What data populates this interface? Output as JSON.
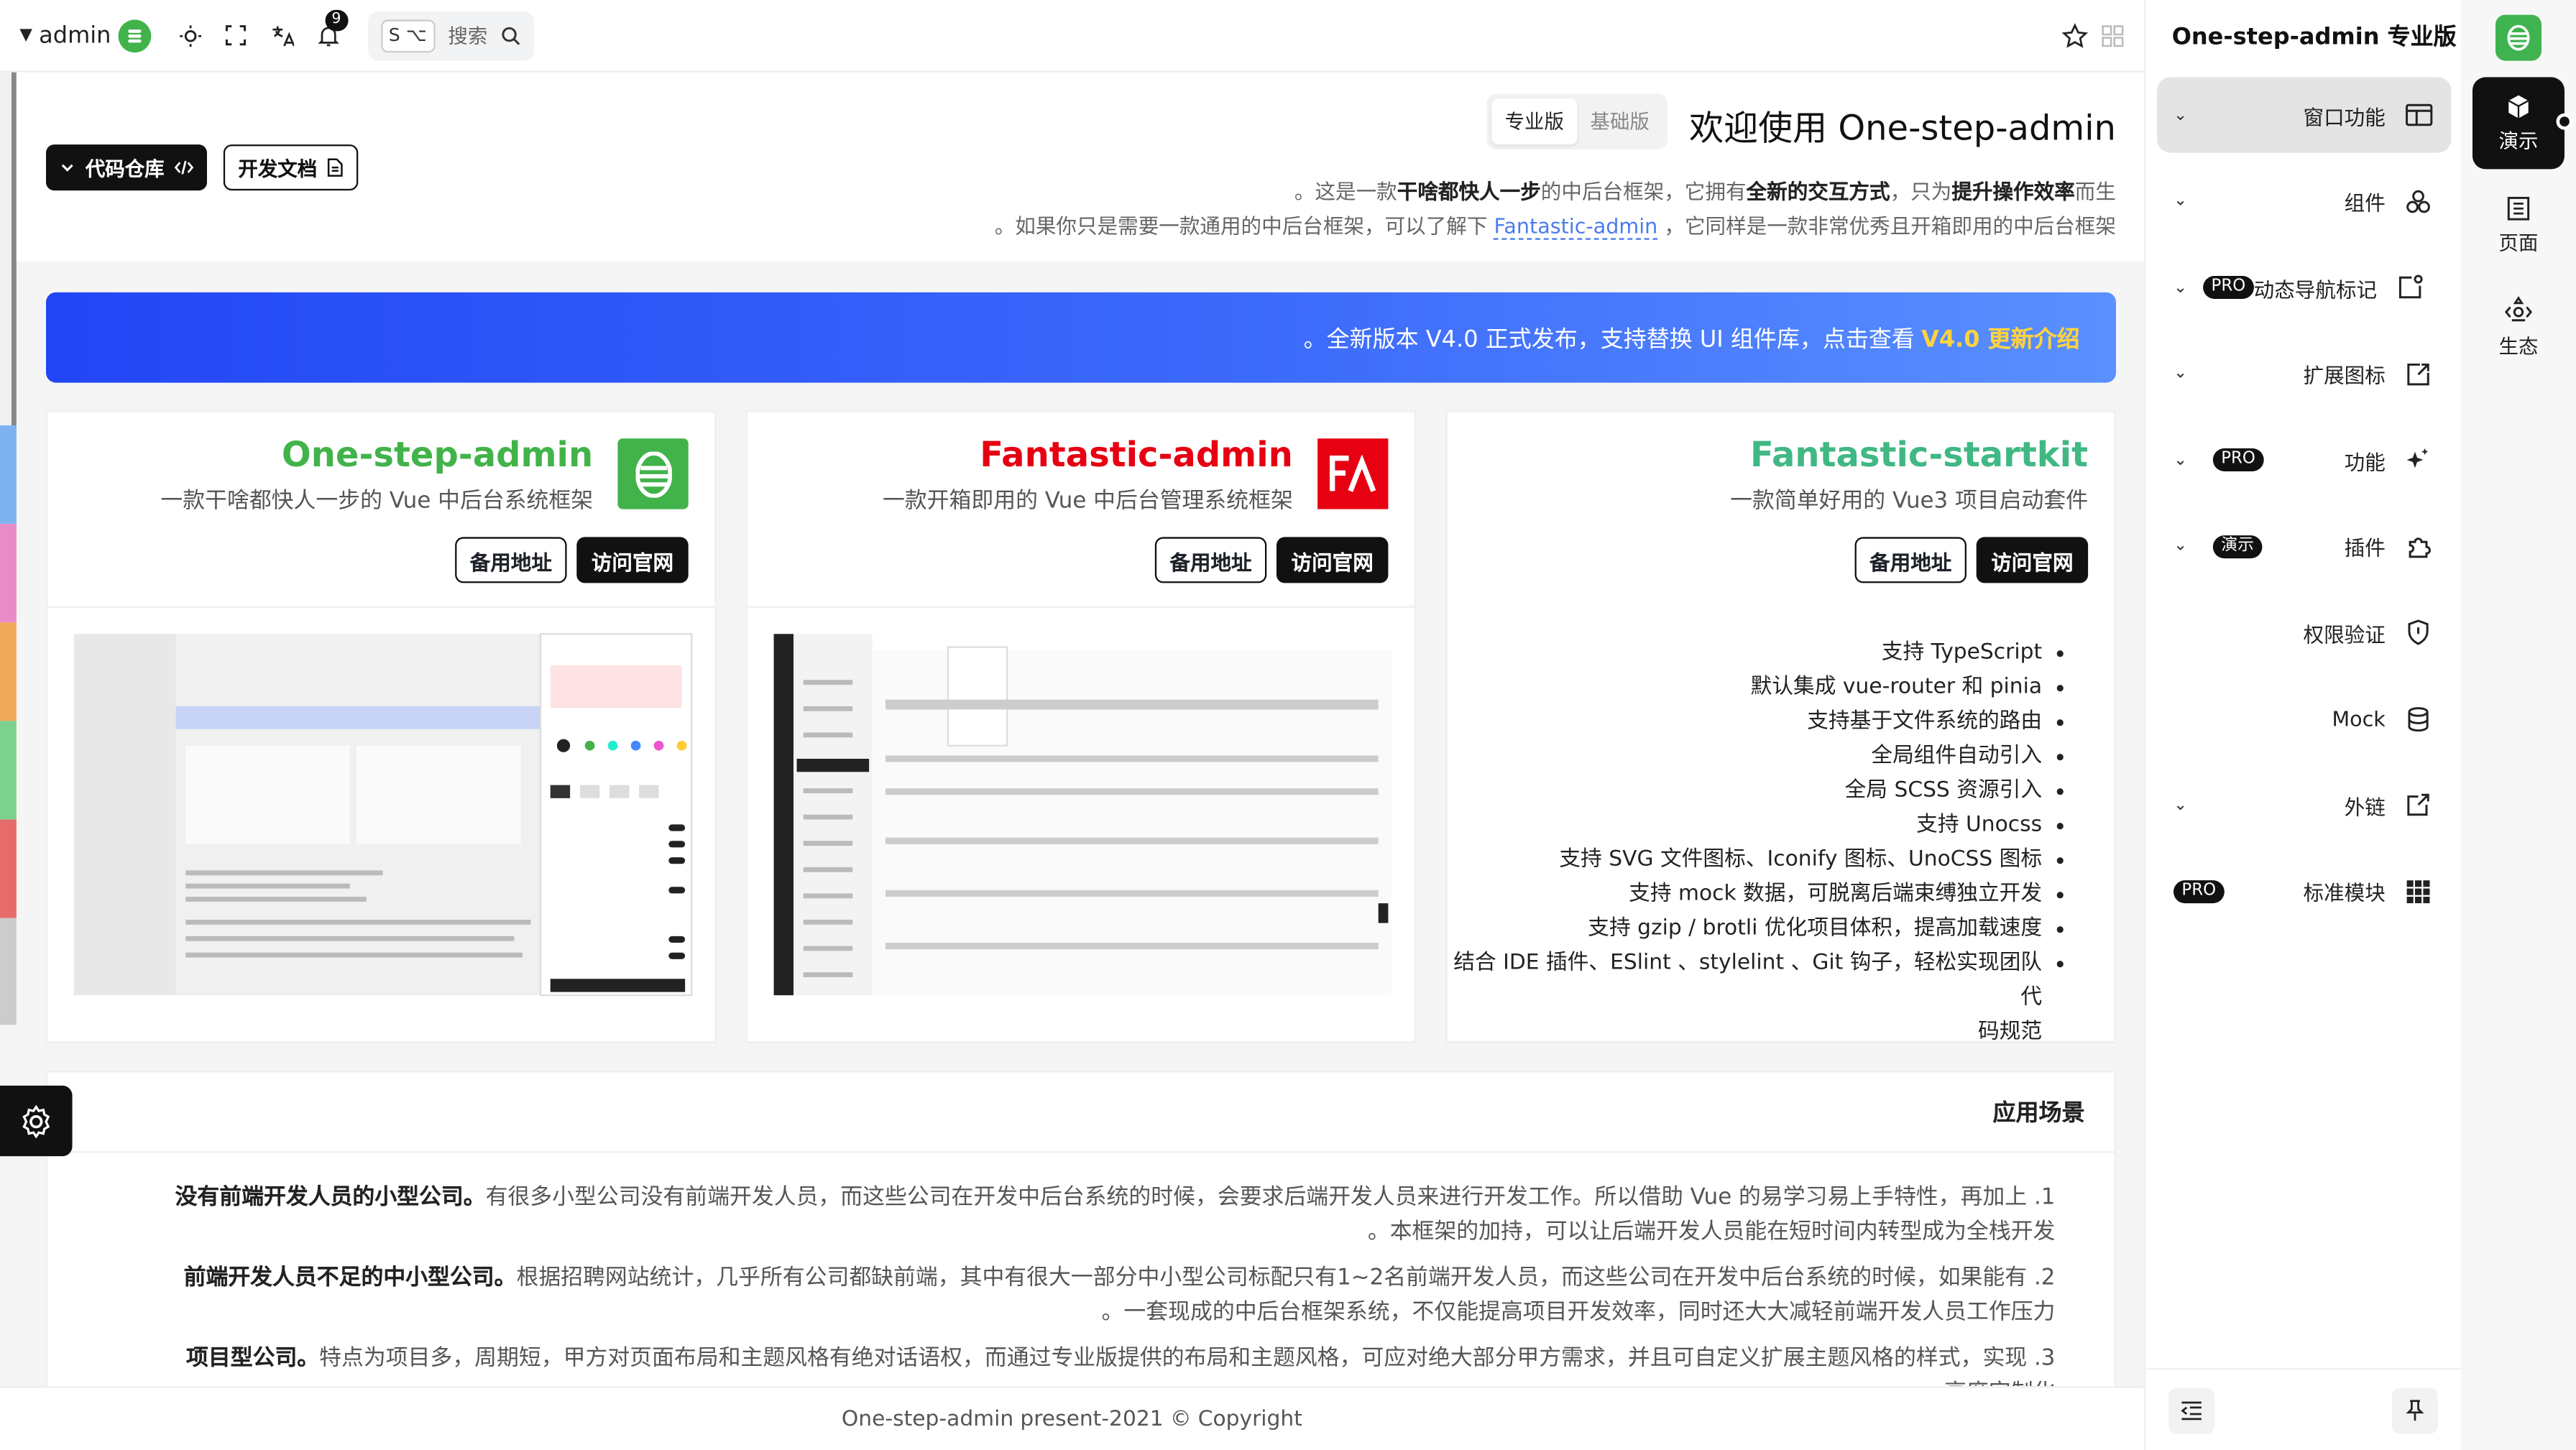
{
  "topbar": {
    "user": "admin",
    "notify_count": "9",
    "search_kbd": "S ⌥",
    "search_label": "搜索"
  },
  "hero": {
    "title": "欢迎使用 One-step-admin",
    "tab_pro": "专业版",
    "tab_basic": "基础版",
    "line1_pre": "。这是一款",
    "line1_b1": "干啥都快人一步",
    "line1_mid": "的中后台框架，它拥有",
    "line1_b2": "全新的交互方式",
    "line1_mid2": "，只为",
    "line1_b3": "提升操作效率",
    "line1_post": "而生",
    "line2_pre": "。如果你只是需要一款通用的中后台框架，可以了解下",
    "line2_link": "Fantastic-admin",
    "line2_post": "，它同样是一款非常优秀且开箱即用的中后台框架",
    "btn_repo": "代码仓库",
    "btn_docs": "开发文档"
  },
  "banner": {
    "text": "。全新版本 V4.0 正式发布，支持替换 UI 组件库，点击查看",
    "highlight": "V4.0 更新介绍"
  },
  "cards": [
    {
      "name": "One-step-admin",
      "desc": "一款干啥都快人一步的 Vue 中后台系统框架",
      "btn1": "备用地址",
      "btn2": "访问官网",
      "color": "#41b34a"
    },
    {
      "name": "Fantastic-admin",
      "desc": "一款开箱即用的 Vue 中后台管理系统框架",
      "btn1": "备用地址",
      "btn2": "访问官网",
      "color": "#e60012"
    },
    {
      "name": "Fantastic-startkit",
      "desc": "一款简单好用的 Vue3 项目启动套件",
      "btn1": "备用地址",
      "btn2": "访问官网",
      "color": "#41b883"
    }
  ],
  "features": [
    "支持 TypeScript",
    "默认集成 vue-router 和 pinia",
    "支持基于文件系统的路由",
    "全局组件自动引入",
    "全局 SCSS 资源引入",
    "支持 Unocss",
    "支持 SVG 文件图标、Iconify 图标、UnoCSS 图标",
    "支持 mock 数据，可脱离后端束缚独立开发",
    "支持 gzip / brotli 优化项目体积，提高加载速度",
    "结合 IDE 插件、ESlint 、stylelint 、Git 钩子，轻松实现团队代",
    "码规范"
  ],
  "scenarios": {
    "title": "应用场景",
    "items": [
      {
        "bold": "没有前端开发人员的小型公司。",
        "text": "有很多小型公司没有前端开发人员，而这些公司在开发中后台系统的时候，会要求后端开发人员来进行开发工作。所以借助 Vue 的易学习易上手特性，再加上 .1",
        "text2": "。本框架的加持，可以让后端开发人员能在短时间内转型成为全栈开发"
      },
      {
        "bold": "前端开发人员不足的中小型公司。",
        "text": "根据招聘网站统计，几乎所有公司都缺前端，其中有很大一部分中小型公司标配只有1~2名前端开发人员，而这些公司在开发中后台系统的时候，如果能有 .2",
        "text2": "。一套现成的中后台框架系统，不仅能提高项目开发效率，同时还大大减轻前端开发人员工作压力"
      },
      {
        "bold": "项目型公司。",
        "text": "特点为项目多，周期短，甲方对页面布局和主题风格有绝对话语权，而通过专业版提供的布局和主题风格，可应对绝大部分甲方需求，并且可自定义扩展主题风格的样式，实现 .3",
        "text2": "高度定制化"
      }
    ]
  },
  "footer": {
    "name": "One-step-admin",
    "year": "present-2021",
    "copy": "Copyright"
  },
  "subside": {
    "brand": "One-step-admin 专业版",
    "items": [
      {
        "label": "窗口功能",
        "chev": "⌄",
        "tag": "",
        "icon": "window-icon"
      },
      {
        "label": "组件",
        "chev": "⌄",
        "tag": "",
        "icon": "components-icon"
      },
      {
        "label": "动态导航标记",
        "chev": "⌄",
        "tag": "PRO",
        "icon": "nav-badge-icon"
      },
      {
        "label": "扩展图标",
        "chev": "⌄",
        "tag": "",
        "icon": "ext-icon"
      },
      {
        "label": "功能",
        "chev": "⌄",
        "tag": "PRO",
        "icon": "sparkle-icon"
      },
      {
        "label": "插件",
        "chev": "⌄",
        "tag": "演示",
        "icon": "plugin-icon"
      },
      {
        "label": "权限验证",
        "chev": "",
        "tag": "",
        "icon": "shield-icon"
      },
      {
        "label": "Mock",
        "chev": "",
        "tag": "",
        "icon": "database-icon"
      },
      {
        "label": "外链",
        "chev": "⌄",
        "tag": "",
        "icon": "external-link-icon"
      },
      {
        "label": "标准模块",
        "chev": "",
        "tag": "PRO",
        "icon": "grid-icon"
      }
    ]
  },
  "mainside": {
    "items": [
      {
        "label": "演示"
      },
      {
        "label": "页面"
      },
      {
        "label": "生态"
      }
    ]
  },
  "colors": {
    "accent": "#111111",
    "brand_green": "#41b34a",
    "banner_blue": "#2246f5",
    "highlight": "#ffd23f"
  }
}
